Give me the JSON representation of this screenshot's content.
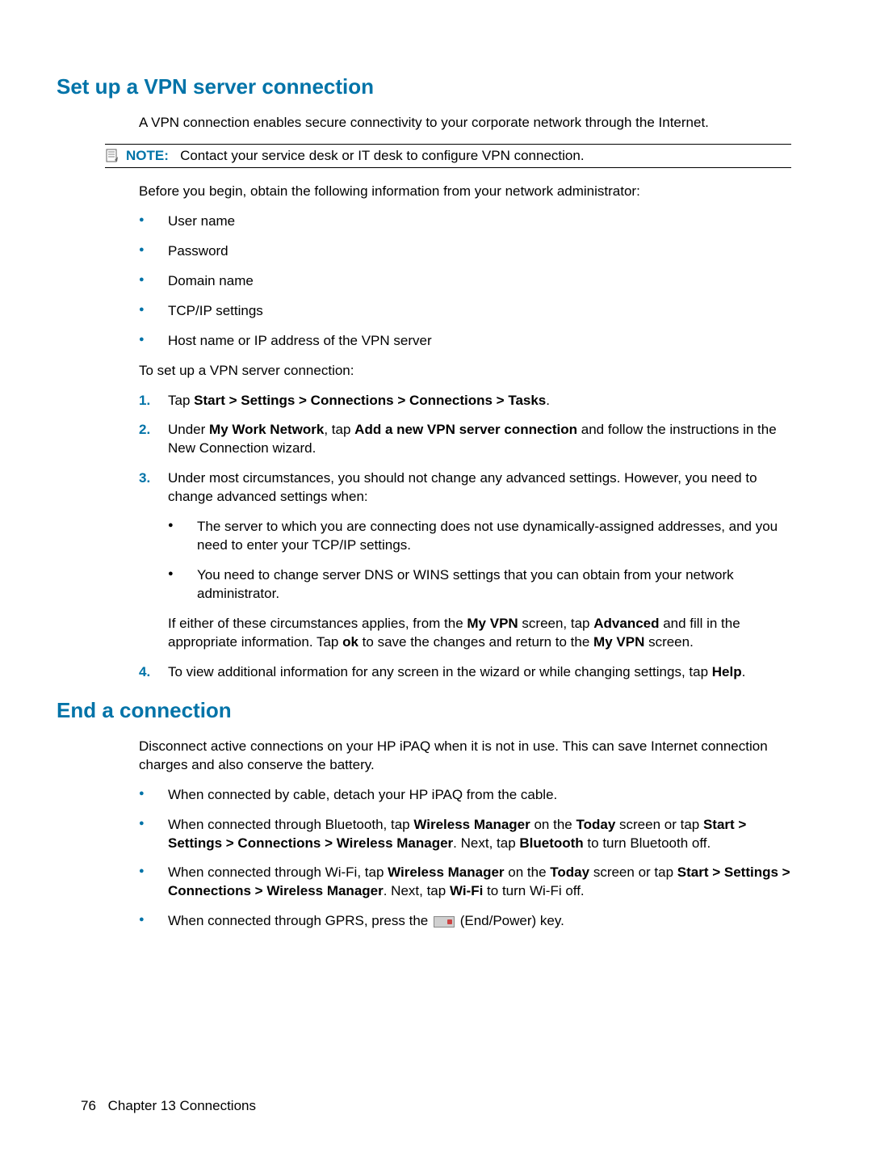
{
  "section1": {
    "heading": "Set up a VPN server connection",
    "intro": "A VPN connection enables secure connectivity to your corporate network through the Internet.",
    "note_label": "NOTE:",
    "note_text": "Contact your service desk or IT desk to configure VPN connection.",
    "before_begin": "Before you begin, obtain the following information from your network administrator:",
    "info_list": [
      "User name",
      "Password",
      "Domain name",
      "TCP/IP settings",
      "Host name or IP address of the VPN server"
    ],
    "to_setup": "To set up a VPN server connection:",
    "steps": {
      "s1_pre": "Tap ",
      "s1_bold": "Start > Settings > Connections > Connections > Tasks",
      "s1_post": ".",
      "s2_pre": "Under ",
      "s2_b1": "My Work Network",
      "s2_mid1": ", tap ",
      "s2_b2": "Add a new VPN server connection",
      "s2_post": " and follow the instructions in the New Connection wizard.",
      "s3_intro": "Under most circumstances, you should not change any advanced settings. However, you need to change advanced settings when:",
      "s3_sub1": "The server to which you are connecting does not use dynamically-assigned addresses, and you need to enter your TCP/IP settings.",
      "s3_sub2": "You need to change server DNS or WINS settings that you can obtain from your network administrator.",
      "s3_follow_pre": "If either of these circumstances applies, from the ",
      "s3_follow_b1": "My VPN",
      "s3_follow_mid1": " screen, tap ",
      "s3_follow_b2": "Advanced",
      "s3_follow_mid2": " and fill in the appropriate information. Tap ",
      "s3_follow_b3": "ok",
      "s3_follow_mid3": " to save the changes and return to the ",
      "s3_follow_b4": "My VPN",
      "s3_follow_post": " screen.",
      "s4_pre": "To view additional information for any screen in the wizard or while changing settings, tap ",
      "s4_b": "Help",
      "s4_post": "."
    }
  },
  "section2": {
    "heading": "End a connection",
    "intro": "Disconnect active connections on your HP iPAQ when it is not in use. This can save Internet connection charges and also conserve the battery.",
    "items": {
      "i1": "When connected by cable, detach your HP iPAQ from the cable.",
      "i2_pre": "When connected through Bluetooth, tap ",
      "i2_b1": "Wireless Manager",
      "i2_mid1": " on the ",
      "i2_b2": "Today",
      "i2_mid2": " screen or tap ",
      "i2_b3": "Start > Settings > Connections > Wireless Manager",
      "i2_mid3": ". Next, tap ",
      "i2_b4": "Bluetooth",
      "i2_post": " to turn Bluetooth off.",
      "i3_pre": "When connected through Wi-Fi, tap ",
      "i3_b1": "Wireless Manager",
      "i3_mid1": " on the ",
      "i3_b2": "Today",
      "i3_mid2": " screen or tap ",
      "i3_b3": "Start > Settings > Connections > Wireless Manager",
      "i3_mid3": ". Next, tap ",
      "i3_b4": "Wi-Fi",
      "i3_post": " to turn Wi-Fi off.",
      "i4_pre": "When connected through GPRS, press the ",
      "i4_post": " (End/Power) key."
    }
  },
  "footer": {
    "page": "76",
    "chapter": "Chapter 13   Connections"
  }
}
